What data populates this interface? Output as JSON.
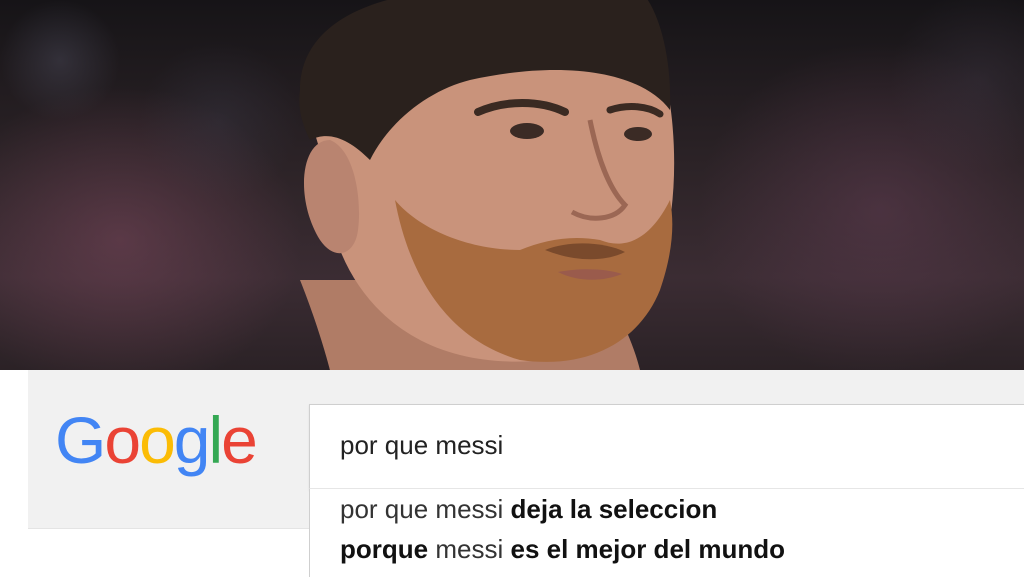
{
  "google": {
    "logo_letters": [
      {
        "char": "G",
        "color": "#4285F4"
      },
      {
        "char": "o",
        "color": "#EA4335"
      },
      {
        "char": "o",
        "color": "#FBBC05"
      },
      {
        "char": "g",
        "color": "#4285F4"
      },
      {
        "char": "l",
        "color": "#34A853"
      },
      {
        "char": "e",
        "color": "#EA4335"
      }
    ]
  },
  "search": {
    "query": "por que messi"
  },
  "suggestions": [
    {
      "prefix": "por que messi",
      "completion": "deja la seleccion"
    },
    {
      "bold_start": "porque",
      "middle": "messi",
      "completion": "es el mejor del mundo"
    }
  ]
}
